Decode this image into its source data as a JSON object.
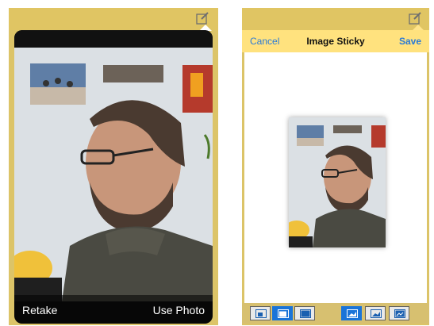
{
  "left_screen": {
    "retake_label": "Retake",
    "use_photo_label": "Use Photo"
  },
  "right_screen": {
    "cancel_label": "Cancel",
    "title": "Image Sticky",
    "save_label": "Save",
    "toolbar": {
      "left_group": [
        "image-small-icon",
        "image-medium-icon",
        "image-large-icon"
      ],
      "right_group": [
        "image-fit-icon",
        "image-fill-icon",
        "image-stretch-icon"
      ]
    }
  },
  "colors": {
    "frame_gold": "#dcc468",
    "header_yellow": "#ffe27e",
    "ios_blue": "#2a7ad6",
    "tool_active": "#1a74d8"
  }
}
